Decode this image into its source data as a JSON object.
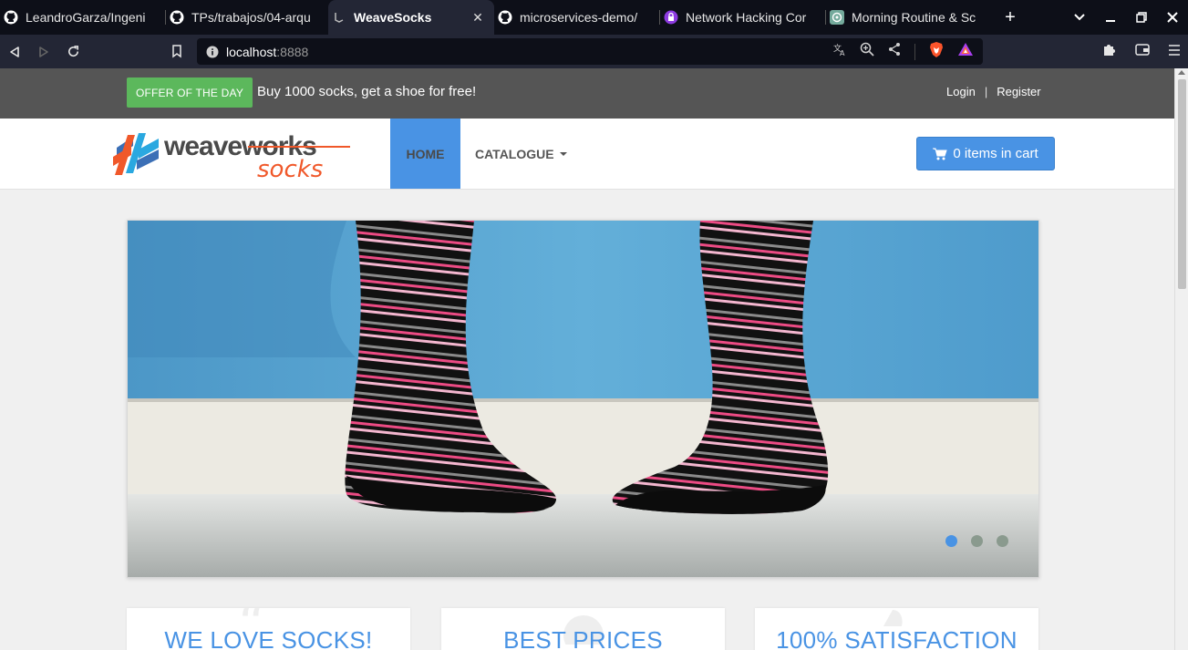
{
  "browser": {
    "tabs": [
      {
        "label": "LeandroGarza/Ingeni",
        "icon": "github-icon"
      },
      {
        "label": "TPs/trabajos/04-arqu",
        "icon": "github-icon"
      },
      {
        "label": "WeaveSocks",
        "icon": "page-icon",
        "active": true
      },
      {
        "label": "microservices-demo/",
        "icon": "github-icon"
      },
      {
        "label": "Network Hacking Cor",
        "icon": "lock-shield-icon"
      },
      {
        "label": "Morning Routine & Sc",
        "icon": "chatgpt-icon"
      }
    ],
    "url_host": "localhost",
    "url_port": ":8888"
  },
  "site": {
    "offer_badge": "OFFER OF THE DAY",
    "offer_text": "Buy 1000 socks, get a shoe for free!",
    "login": "Login",
    "separator": "|",
    "register": "Register",
    "logo_main": "weaveworks",
    "logo_sub": "socks",
    "nav": {
      "home": "HOME",
      "catalogue": "CATALOGUE"
    },
    "cart_label": "0 items in cart",
    "carousel": {
      "slide_count": 3,
      "active_slide": 1
    },
    "features": [
      {
        "title": "WE LOVE SOCKS!"
      },
      {
        "title": "BEST PRICES"
      },
      {
        "title": "100% SATISFACTION"
      }
    ],
    "colors": {
      "accent": "#4993e4",
      "offer_green": "#5cb85c",
      "topbar": "#555555",
      "logo_orange": "#f0582a"
    }
  }
}
